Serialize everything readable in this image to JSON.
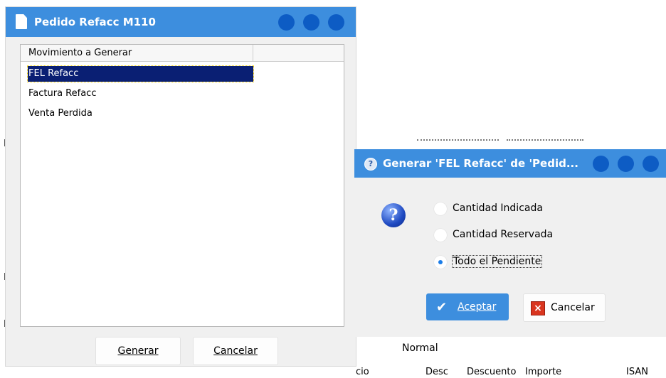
{
  "order_window": {
    "title": "Pedido Refacc M110",
    "list_header": "Movimiento a Generar",
    "items": [
      "FEL Refacc",
      "Factura Refacc",
      "Venta Perdida"
    ],
    "selected_index": 0,
    "generate_label": "Generar",
    "cancel_label": "Cancelar"
  },
  "generate_dialog": {
    "title": "Generar 'FEL Refacc' de 'Pedid...",
    "options": [
      "Cantidad Indicada",
      "Cantidad Reservada",
      "Todo el Pendiente"
    ],
    "selected_option": 2,
    "accept_label": "Aceptar",
    "cancel_label": "Cancelar"
  },
  "background": {
    "normal_label": "Normal",
    "columns": [
      "cio",
      "Desc",
      "Descuento",
      "Importe",
      "ISAN"
    ]
  },
  "colors": {
    "titlebar": "#3d8ede",
    "window_buttons": "#0d5cc4",
    "selection": "#0a1f73"
  }
}
